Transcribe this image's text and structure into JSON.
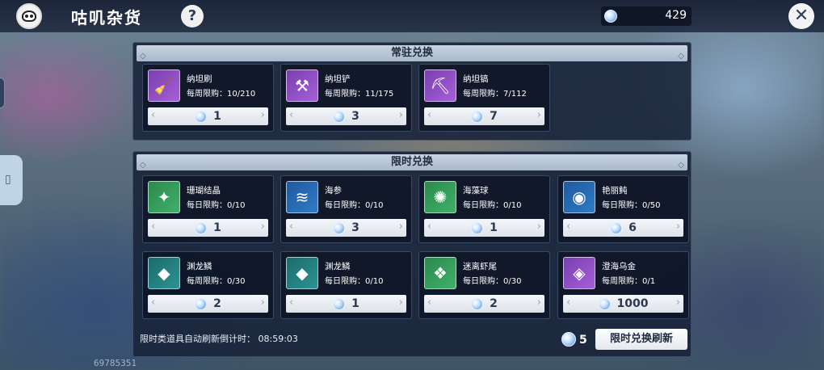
{
  "header": {
    "title": "咕叽杂货",
    "help_symbol": "?",
    "currency_value": "429",
    "close_symbol": "✕"
  },
  "permanent": {
    "title": "常驻兑换",
    "items": [
      {
        "name": "纳坦刷",
        "limit": "每周限购：10/210",
        "price": "1",
        "icon": "broom-icon"
      },
      {
        "name": "纳坦铲",
        "limit": "每周限购：11/175",
        "price": "3",
        "icon": "shovel-icon"
      },
      {
        "name": "纳坦镐",
        "limit": "每周限购：7/112",
        "price": "7",
        "icon": "pickaxe-icon"
      }
    ]
  },
  "limited": {
    "title": "限时兑换",
    "items": [
      {
        "name": "珊瑚结晶",
        "limit": "每日限购：0/10",
        "price": "1",
        "icon": "coral-crystal-icon"
      },
      {
        "name": "海参",
        "limit": "每日限购：0/10",
        "price": "3",
        "icon": "sea-cucumber-icon"
      },
      {
        "name": "海藻球",
        "limit": "每日限购：0/10",
        "price": "1",
        "icon": "algae-ball-icon"
      },
      {
        "name": "艳丽鲀",
        "limit": "每日限购：0/50",
        "price": "6",
        "icon": "pufferfish-icon"
      },
      {
        "name": "渊龙鳞",
        "limit": "每周限购：0/30",
        "price": "2",
        "icon": "dragon-scale-icon"
      },
      {
        "name": "渊龙鳞",
        "limit": "每日限购：0/10",
        "price": "1",
        "icon": "dragon-scale-icon"
      },
      {
        "name": "迷离虾尾",
        "limit": "每日限购：0/30",
        "price": "2",
        "icon": "shrimp-tail-icon"
      },
      {
        "name": "澄海乌金",
        "limit": "每周限购：0/1",
        "price": "1000",
        "icon": "dark-gold-icon"
      }
    ],
    "countdown_text": "限时类道具自动刷新倒计时：  08:59:03",
    "refresh_cost": "5",
    "refresh_label": "限时兑换刷新"
  },
  "uid": "69785351",
  "colors": {
    "panel": "#18223a",
    "header_bar": "#c8d4e2",
    "price_bar": "#f4f6f9"
  }
}
